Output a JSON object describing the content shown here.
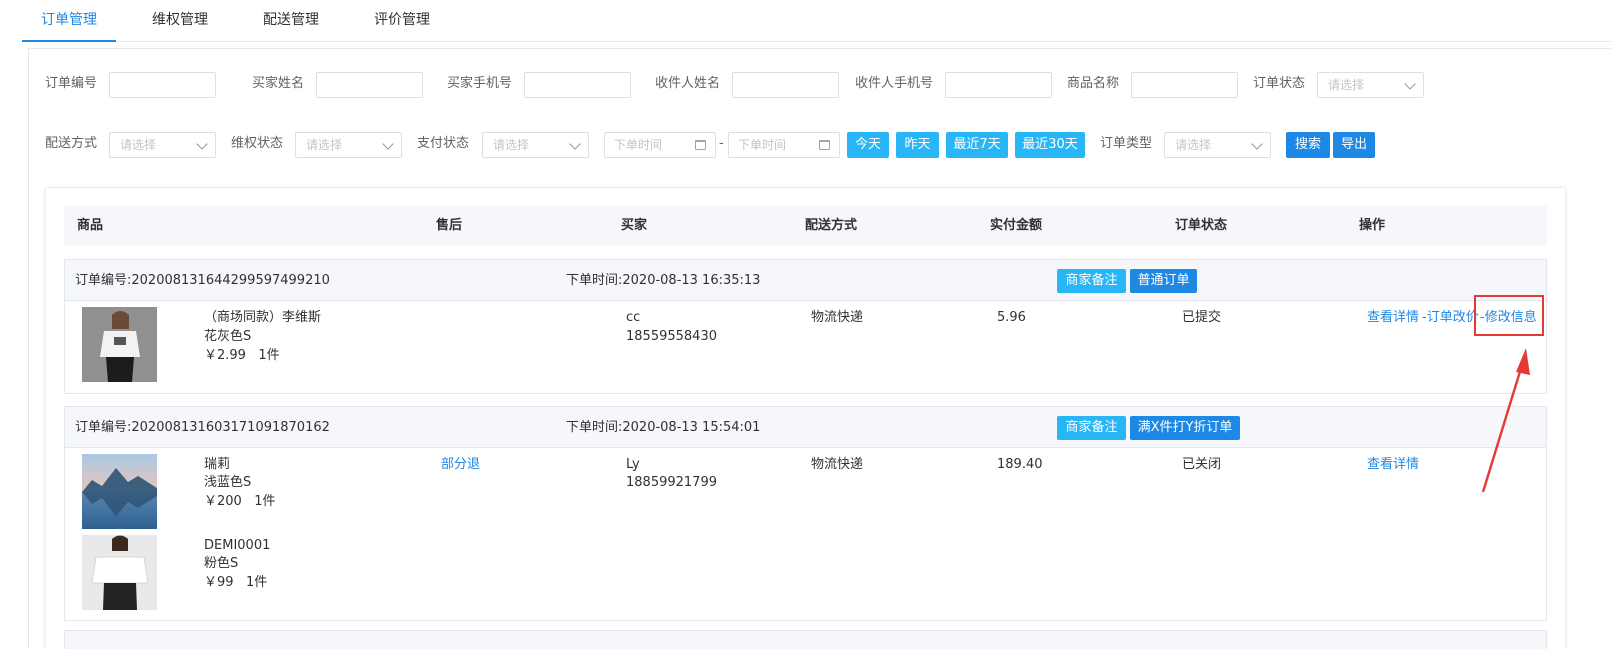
{
  "tabs": [
    "订单管理",
    "维权管理",
    "配送管理",
    "评价管理"
  ],
  "filters": {
    "order_no": "订单编号",
    "buyer_name": "买家姓名",
    "buyer_phone": "买家手机号",
    "receiver_name": "收件人姓名",
    "receiver_phone": "收件人手机号",
    "product_name": "商品名称",
    "order_status": "订单状态",
    "delivery": "配送方式",
    "rights_status": "维权状态",
    "pay_status": "支付状态",
    "order_type": "订单类型",
    "select_placeholder": "请选择",
    "date_placeholder": "下单时间",
    "range_sep": "-",
    "quick": [
      "今天",
      "昨天",
      "最近7天",
      "最近30天"
    ],
    "search": "搜索",
    "export": "导出"
  },
  "columns": [
    "商品",
    "售后",
    "买家",
    "配送方式",
    "实付金额",
    "订单状态",
    "操作"
  ],
  "orders": [
    {
      "order_no": "订单编号:20200813164429959749921​0",
      "time": "下单时间:2020-08-13 16:35:13",
      "tags": [
        "商家备注",
        "普通订单"
      ],
      "items": [
        {
          "name": "（商场同款）李维斯",
          "spec": "花灰色S",
          "price": "￥2.99",
          "qty": "1件"
        }
      ],
      "after_sale": "",
      "buyer": "cc",
      "buyer_phone": "18559558430",
      "delivery": "物流快递",
      "amount": "5.96",
      "status": "已提交",
      "actions": [
        "查看详情",
        "-订单改价",
        "-修改信息"
      ]
    },
    {
      "order_no": "订单编号:20200813160317109187016​2",
      "time": "下单时间:2020-08-13 15:54:01",
      "tags": [
        "商家备注",
        "满X件打Y折订单"
      ],
      "items": [
        {
          "name": "瑞莉",
          "spec": "浅蓝色S",
          "price": "￥200",
          "qty": "1件"
        },
        {
          "name": "DEMI0001",
          "spec": "粉色S",
          "price": "￥99",
          "qty": "1件"
        }
      ],
      "after_sale": "部分退",
      "buyer": "Ly",
      "buyer_phone": "18859921799",
      "delivery": "物流快递",
      "amount": "189.40",
      "status": "已关闭",
      "actions": [
        "查看详情"
      ]
    }
  ],
  "colors": {
    "primary": "#1e88e5",
    "cyan": "#29b6f6",
    "annotation": "#e53935"
  }
}
